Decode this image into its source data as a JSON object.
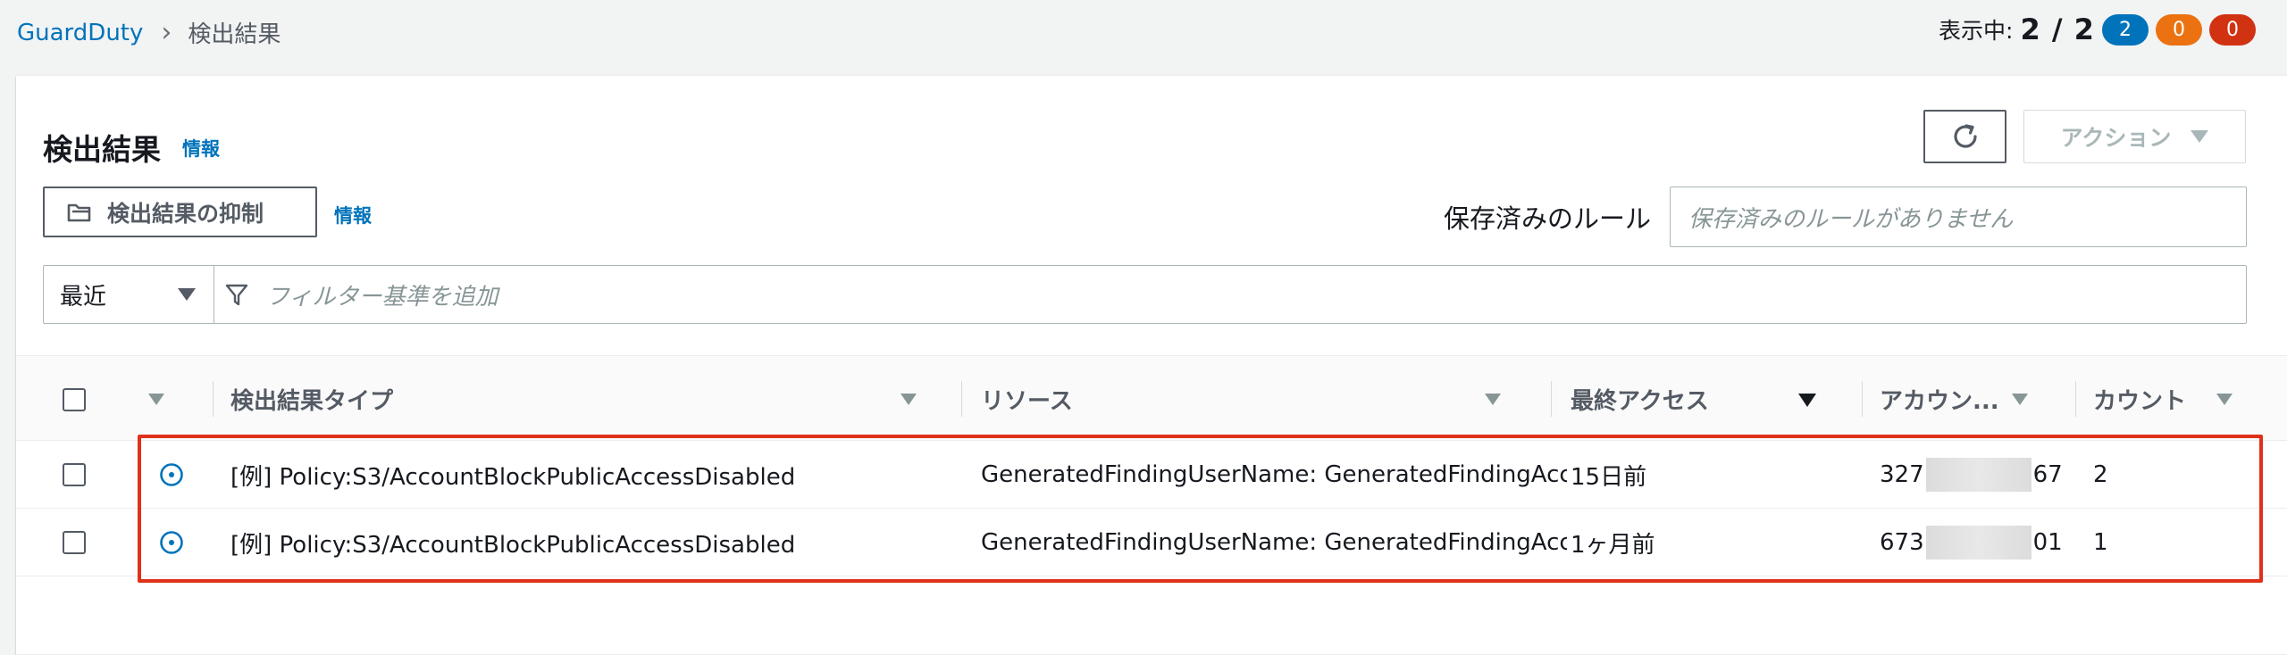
{
  "breadcrumb": {
    "service": "GuardDuty",
    "current": "検出結果"
  },
  "counter": {
    "label": "表示中:",
    "value": "2 / 2",
    "severity": {
      "low": "2",
      "medium": "0",
      "high": "0"
    }
  },
  "colors": {
    "link": "#0073bb",
    "low": "#0073bb",
    "medium": "#ec7211",
    "high": "#d13212",
    "highlight": "#e0311b"
  },
  "panel": {
    "title": "検出結果",
    "title_info": "情報",
    "refresh_icon": "refresh-icon",
    "action_label": "アクション",
    "suppress_label": "検出結果の抑制",
    "suppress_info": "情報",
    "saved_rules_label": "保存済みのルール",
    "saved_rules_placeholder": "保存済みのルールがありません",
    "filter_select": "最近",
    "filter_placeholder": "フィルター基準を追加"
  },
  "table": {
    "headers": {
      "type": "検出結果タイプ",
      "resource": "リソース",
      "last_seen": "最終アクセス",
      "account": "アカウン...",
      "count": "カウント"
    },
    "rows": [
      {
        "type": "[例] Policy:S3/AccountBlockPublicAccessDisabled",
        "resource": "GeneratedFindingUserName: GeneratedFindingAccessKeyId",
        "last_seen": "15日前",
        "account_prefix": "327",
        "account_suffix": "67",
        "count": "2"
      },
      {
        "type": "[例] Policy:S3/AccountBlockPublicAccessDisabled",
        "resource": "GeneratedFindingUserName: GeneratedFindingAccessKeyId",
        "last_seen": "1ヶ月前",
        "account_prefix": "673",
        "account_suffix": "01",
        "count": "1"
      }
    ]
  }
}
